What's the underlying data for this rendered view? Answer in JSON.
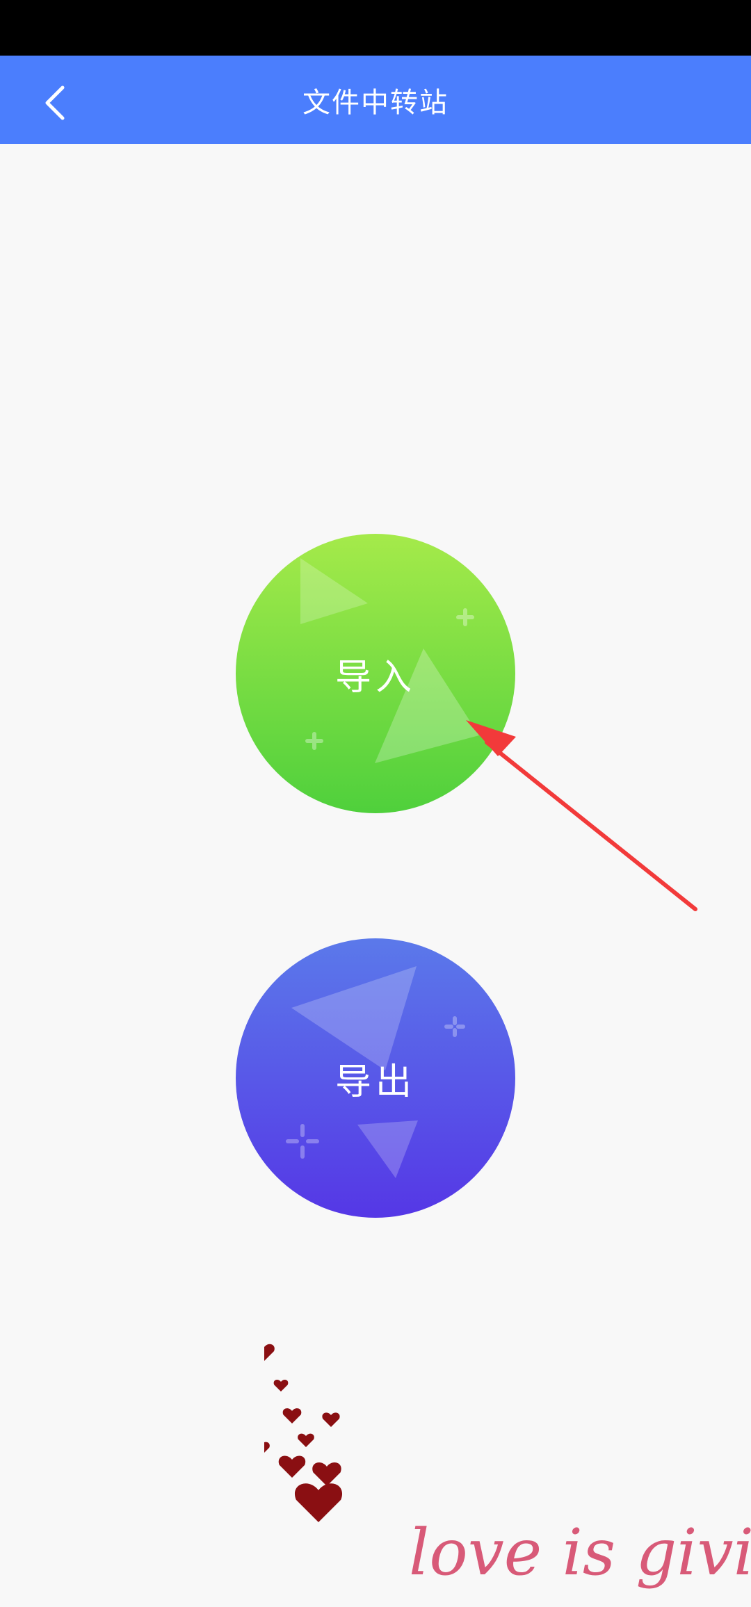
{
  "header": {
    "title": "文件中转站",
    "back_icon": "chevron-left-icon"
  },
  "buttons": {
    "import_label": "导入",
    "export_label": "导出"
  },
  "watermark": {
    "text": "love is giving"
  },
  "colors": {
    "app_bar": "#4b7efd",
    "background": "#f8f8f8",
    "import_top": "#a5ea4a",
    "import_bottom": "#4fd03c",
    "export_top": "#5b79ea",
    "export_bottom": "#5537e6",
    "annotation_arrow": "#f23a3a"
  }
}
